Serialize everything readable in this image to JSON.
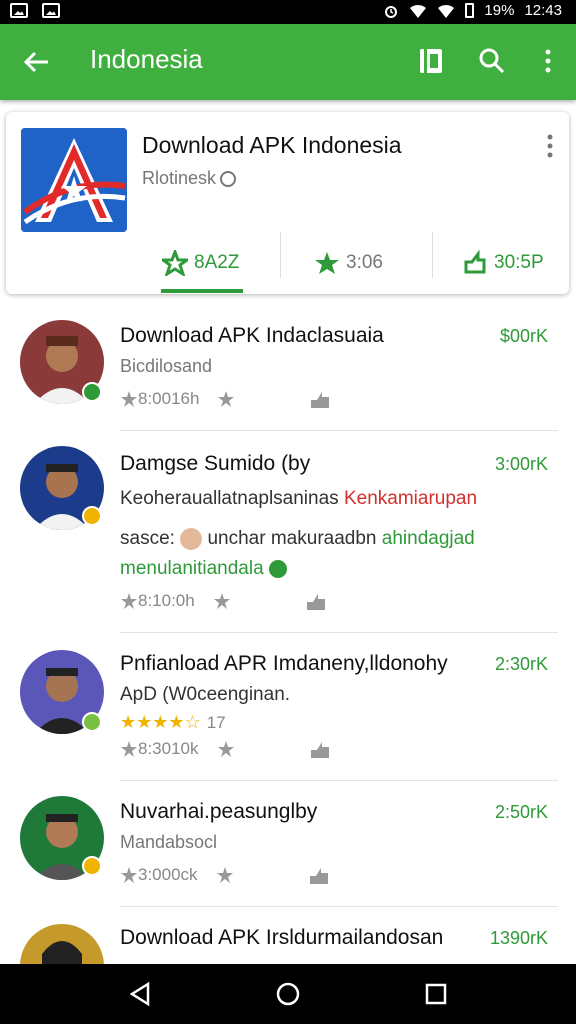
{
  "status_bar": {
    "battery": "19%",
    "time": "12:43"
  },
  "app_bar": {
    "title": "Indonesia"
  },
  "app_card": {
    "title": "Download APK Indonesia",
    "subtitle": "Rlotinesk",
    "tabs": [
      {
        "label": "8A2Z"
      },
      {
        "label": "3:06"
      },
      {
        "label": "30:5P"
      }
    ]
  },
  "items": [
    {
      "title": "Download APK Indaclasuaia",
      "size": "$00rK",
      "sub": "Bicdilosand",
      "meta": "8:0016h"
    },
    {
      "title": "Damgse Sumido (by",
      "size": "3:00rK",
      "desc_line1": "Keoherauallatnaplsaninas",
      "desc_line1_red": "Kenkamiarupan",
      "desc_line2": "sasce:",
      "desc_line2b": "unchar makuraadbn",
      "desc_line2_green": "ahindagjad",
      "desc_line3_green": "menulanitiandala",
      "meta": "8:10:0h"
    },
    {
      "title": "Pnfianload APR Imdaneny,lldonohy",
      "size": "2:30rK",
      "sub": "ApD (W0ceenginan.",
      "rating": "17",
      "meta": "8:3010k"
    },
    {
      "title": "Nuvarhai.peasunglby",
      "size": "2:50rK",
      "sub": "Mandabsocl",
      "meta": "3:000ck"
    },
    {
      "title": "Download APK Irsldurmailandosan",
      "size": "1390rK"
    }
  ]
}
